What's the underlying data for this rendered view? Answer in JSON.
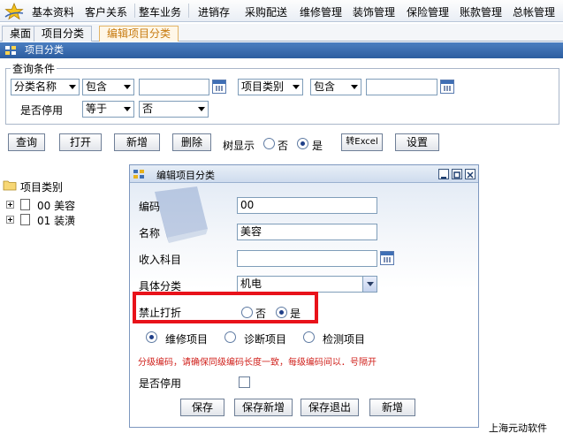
{
  "menu": {
    "items": [
      "基本资料",
      "客户关系",
      "整车业务",
      "进销存",
      "采购配送",
      "维修管理",
      "装饰管理",
      "保险管理",
      "账款管理",
      "总帐管理"
    ]
  },
  "tabs": [
    "桌面",
    "项目分类",
    "编辑项目分类"
  ],
  "panel": {
    "title": "项目分类"
  },
  "query": {
    "legend": "查询条件",
    "field1": "分类名称",
    "op1": "包含",
    "field2": "项目类别",
    "op2": "包含",
    "disabled_label": "是否停用",
    "op3": "等于",
    "value3": "否"
  },
  "toolbar": {
    "query": "查询",
    "open": "打开",
    "add": "新增",
    "delete": "删除",
    "tree_label": "树显示",
    "no": "否",
    "yes": "是",
    "excel": "转Excel",
    "settings": "设置"
  },
  "tree": {
    "root": "项目类别",
    "items": [
      "00 美容",
      "01 装潢"
    ]
  },
  "dialog": {
    "title": "编辑项目分类",
    "code_label": "编码",
    "code_value": "00",
    "name_label": "名称",
    "name_value": "美容",
    "income_label": "收入科目",
    "category_label": "具体分类",
    "category_value": "机电",
    "discount_label": "禁止打折",
    "no": "否",
    "yes": "是",
    "type_repair": "维修项目",
    "type_diag": "诊断项目",
    "type_check": "检测项目",
    "hint": "分级编码，请确保同级编码长度一致，每级编码间以．号隔开",
    "disabled_label": "是否停用",
    "save": "保存",
    "save_add": "保存新增",
    "save_exit": "保存退出",
    "add": "新增"
  },
  "footer": "上海元动软件",
  "colors": {
    "header_blue": "#2c5d9f",
    "hint_red": "#d0201b",
    "highlight_red": "#e8121a",
    "tab_active": "#c77b10"
  }
}
